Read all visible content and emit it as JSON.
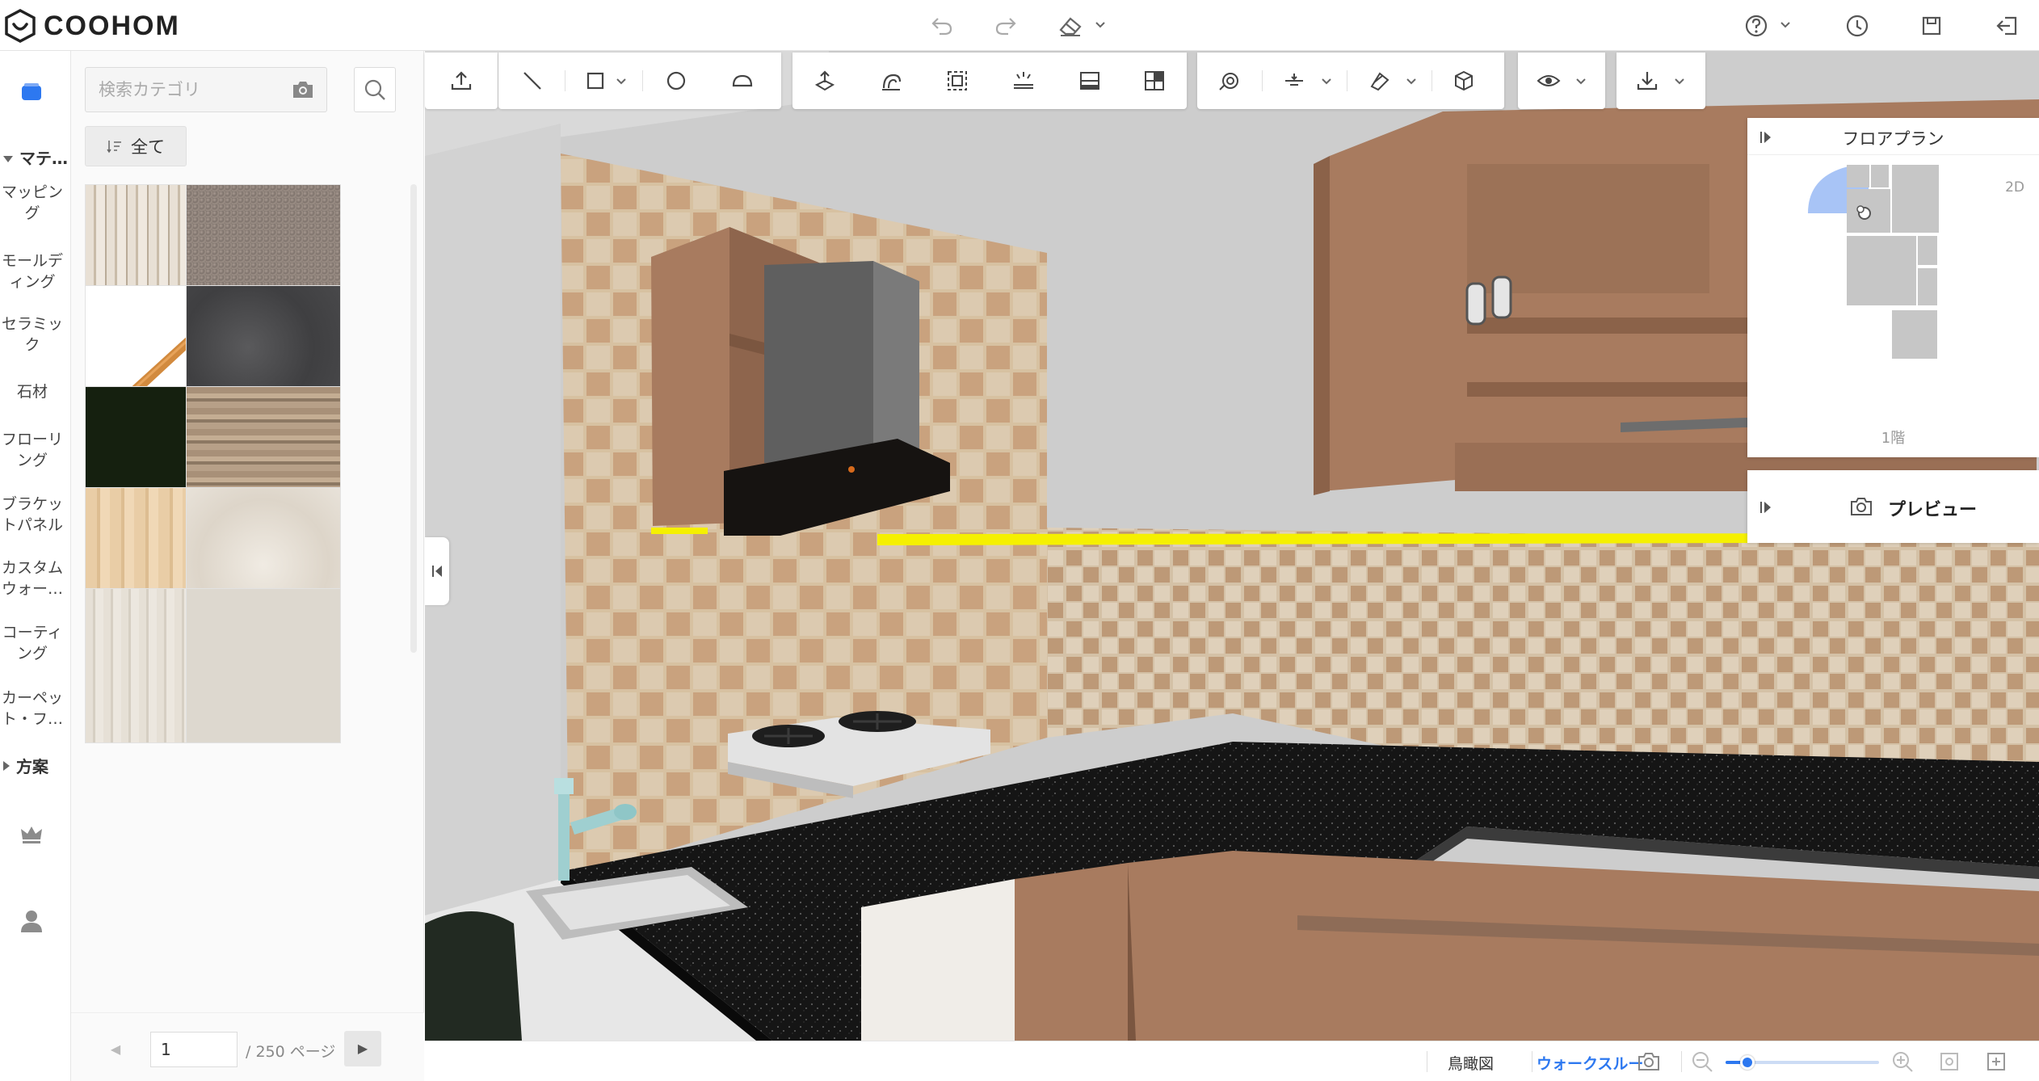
{
  "app": {
    "brand": "COOHOM"
  },
  "header": {
    "icons": [
      "undo-icon",
      "redo-icon",
      "eraser-icon",
      "help-icon",
      "history-icon",
      "save-icon",
      "exit-icon"
    ]
  },
  "rail": {
    "section_materials": "マテ…",
    "categories": [
      "マッピング",
      "モールディング",
      "セラミック",
      "石材",
      "フローリング",
      "ブラケットパネル",
      "カスタムウォー…",
      "コーティング",
      "カーペット・フ…"
    ],
    "section_plans": "方案"
  },
  "panel": {
    "search_placeholder": "検索カテゴリ",
    "all_label": "全て",
    "pager": {
      "page": "1",
      "total_label": "/ 250 ページ"
    }
  },
  "toolbar": {
    "icons": [
      "upload-icon",
      "line-icon",
      "rectangle-icon",
      "circle-icon",
      "arc-icon",
      "extrude-icon",
      "sweep-icon",
      "select-area-icon",
      "ceiling-light-icon",
      "cabinet-icon",
      "layout-icon",
      "camera-orbit-icon",
      "align-icon",
      "paint-icon",
      "material-box-icon",
      "view-eye-icon",
      "download-icon"
    ]
  },
  "floorplan": {
    "title": "フロアプラン",
    "mode": "2D",
    "floor_label": "1階"
  },
  "preview": {
    "label": "プレビュー"
  },
  "bottombar": {
    "birdseye": "鳥瞰図",
    "walkthrough": "ウォークスルー"
  },
  "zoom": {
    "level": 0.14
  },
  "colors": {
    "accent": "#2d78f0",
    "highlight": "#f5f000",
    "cabinet": "#a87b5f",
    "countertop": "#121212"
  }
}
